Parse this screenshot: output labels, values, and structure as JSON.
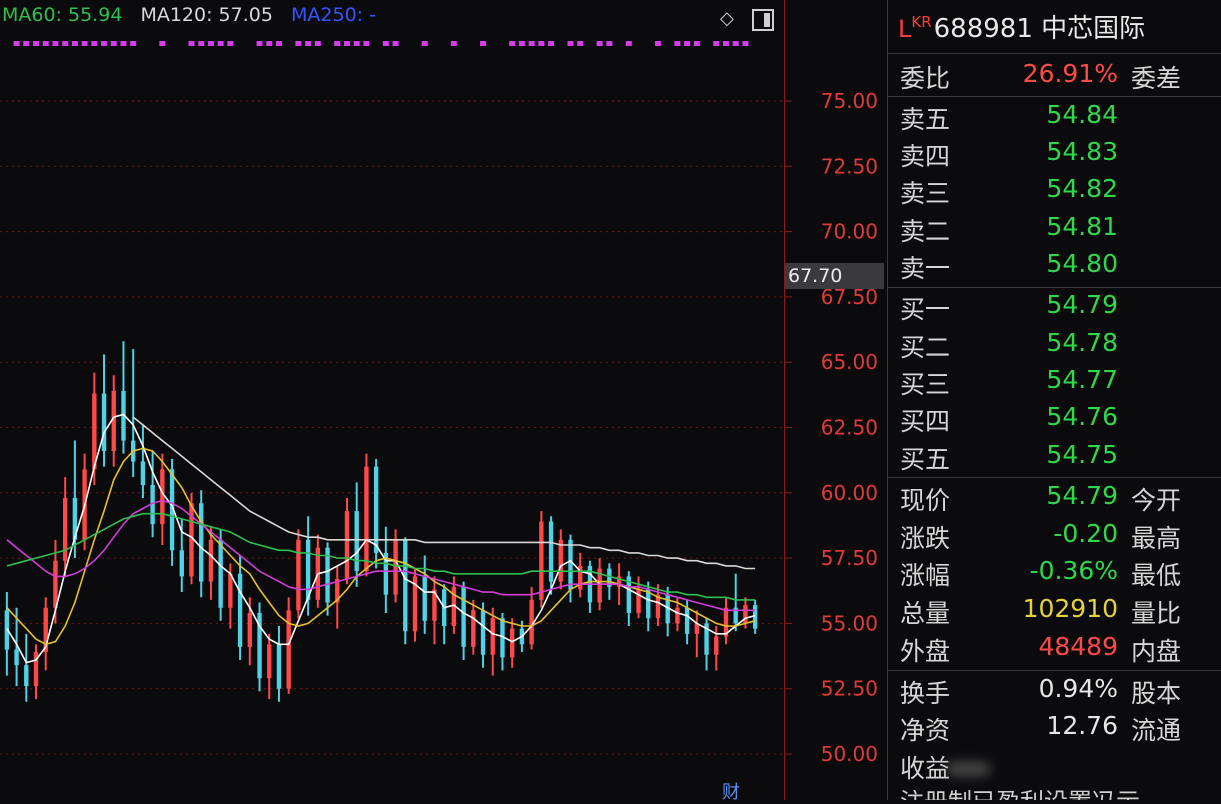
{
  "legend": {
    "ma60": "MA60: 55.94",
    "ma120": "MA120: 57.05",
    "ma250": "MA250: -"
  },
  "icons": {
    "diamond": "diamond-icon",
    "panel": "panel-toggle-icon"
  },
  "badge": "财",
  "current_price_tag": "67.70",
  "colors": {
    "background": "#0b0b0d",
    "up": "#ff4848",
    "down": "#2fd84a",
    "bar_down": "#4fd2e6",
    "grid": "#7a1414",
    "ma5": "#ffffff",
    "ma10": "#e6c229",
    "ma20": "#d43cd8",
    "ma60": "#2fbf4f",
    "ma120": "#d8d8d8",
    "signal": "#d63cf0"
  },
  "chart_data": {
    "type": "candlestick",
    "y_ticks": [
      "75.00",
      "72.50",
      "70.00",
      "67.50",
      "65.00",
      "62.50",
      "60.00",
      "57.50",
      "55.00",
      "52.50",
      "50.00"
    ],
    "ylim": [
      49.5,
      77.5
    ],
    "candles": [
      [
        55.5,
        56.2,
        53.0,
        54.0
      ],
      [
        54.0,
        55.6,
        52.6,
        53.4
      ],
      [
        53.4,
        54.6,
        52.0,
        52.6
      ],
      [
        52.6,
        54.2,
        52.1,
        53.9
      ],
      [
        53.9,
        56.0,
        53.2,
        55.6
      ],
      [
        55.6,
        58.2,
        55.0,
        57.4
      ],
      [
        57.4,
        60.6,
        56.8,
        59.8
      ],
      [
        59.8,
        62.0,
        57.5,
        58.2
      ],
      [
        58.2,
        61.5,
        57.8,
        60.9
      ],
      [
        60.9,
        64.6,
        60.3,
        63.8
      ],
      [
        63.8,
        65.3,
        61.0,
        61.6
      ],
      [
        61.6,
        64.5,
        61.0,
        63.9
      ],
      [
        63.9,
        65.8,
        61.5,
        62.0
      ],
      [
        62.0,
        65.5,
        60.6,
        61.2
      ],
      [
        61.2,
        62.6,
        59.8,
        60.3
      ],
      [
        60.3,
        61.6,
        58.3,
        58.8
      ],
      [
        58.8,
        61.5,
        58.0,
        60.9
      ],
      [
        60.9,
        61.3,
        57.2,
        57.8
      ],
      [
        57.8,
        59.0,
        56.2,
        56.8
      ],
      [
        56.8,
        60.0,
        56.5,
        59.6
      ],
      [
        59.6,
        60.1,
        56.0,
        56.6
      ],
      [
        56.6,
        58.7,
        55.9,
        58.2
      ],
      [
        58.2,
        58.6,
        55.1,
        55.6
      ],
      [
        55.6,
        57.3,
        54.8,
        56.9
      ],
      [
        56.9,
        57.6,
        53.6,
        54.1
      ],
      [
        54.1,
        56.0,
        53.4,
        55.4
      ],
      [
        55.4,
        55.8,
        52.4,
        52.9
      ],
      [
        52.9,
        54.6,
        52.1,
        54.2
      ],
      [
        54.2,
        54.9,
        52.0,
        52.5
      ],
      [
        52.5,
        56.0,
        52.3,
        55.5
      ],
      [
        55.5,
        58.6,
        55.2,
        58.2
      ],
      [
        58.2,
        59.1,
        55.3,
        55.9
      ],
      [
        55.9,
        58.4,
        55.6,
        57.9
      ],
      [
        57.9,
        58.1,
        55.3,
        55.8
      ],
      [
        55.8,
        57.2,
        54.8,
        56.7
      ],
      [
        56.7,
        59.8,
        56.5,
        59.3
      ],
      [
        59.3,
        60.4,
        56.4,
        57.0
      ],
      [
        57.0,
        61.5,
        56.8,
        61.0
      ],
      [
        61.0,
        61.3,
        57.1,
        57.7
      ],
      [
        57.7,
        58.7,
        55.4,
        56.1
      ],
      [
        56.1,
        58.6,
        55.8,
        58.2
      ],
      [
        58.2,
        58.3,
        54.2,
        54.7
      ],
      [
        54.7,
        57.1,
        54.3,
        56.8
      ],
      [
        56.8,
        57.6,
        54.6,
        55.1
      ],
      [
        55.1,
        56.8,
        54.2,
        56.3
      ],
      [
        56.3,
        56.5,
        54.2,
        54.9
      ],
      [
        54.9,
        56.8,
        54.6,
        56.4
      ],
      [
        56.4,
        56.6,
        53.6,
        54.1
      ],
      [
        54.1,
        55.9,
        53.8,
        55.5
      ],
      [
        55.5,
        55.8,
        53.3,
        53.8
      ],
      [
        53.8,
        55.6,
        53.0,
        55.2
      ],
      [
        55.2,
        55.4,
        53.2,
        53.7
      ],
      [
        53.7,
        55.2,
        53.3,
        54.8
      ],
      [
        54.8,
        55.1,
        53.9,
        54.2
      ],
      [
        54.2,
        56.4,
        54.0,
        55.9
      ],
      [
        55.9,
        59.3,
        55.6,
        58.9
      ],
      [
        58.9,
        59.1,
        56.1,
        56.6
      ],
      [
        56.6,
        58.6,
        56.3,
        58.2
      ],
      [
        58.2,
        58.4,
        55.8,
        56.3
      ],
      [
        56.3,
        57.7,
        56.0,
        57.2
      ],
      [
        57.2,
        57.4,
        55.4,
        55.8
      ],
      [
        55.8,
        57.5,
        55.5,
        57.1
      ],
      [
        57.1,
        57.3,
        55.9,
        56.4
      ],
      [
        56.4,
        57.3,
        55.7,
        56.8
      ],
      [
        56.8,
        57.0,
        54.9,
        55.4
      ],
      [
        55.4,
        56.8,
        55.2,
        56.3
      ],
      [
        56.3,
        56.6,
        54.7,
        55.2
      ],
      [
        55.2,
        56.5,
        54.9,
        56.1
      ],
      [
        56.1,
        56.4,
        54.5,
        55.0
      ],
      [
        55.0,
        56.0,
        54.7,
        55.6
      ],
      [
        55.6,
        55.9,
        54.2,
        54.6
      ],
      [
        54.6,
        55.5,
        53.7,
        55.0
      ],
      [
        55.0,
        55.2,
        53.2,
        53.8
      ],
      [
        53.8,
        54.9,
        53.2,
        54.5
      ],
      [
        54.5,
        56.0,
        54.2,
        55.6
      ],
      [
        55.6,
        56.9,
        54.7,
        55.0
      ],
      [
        55.0,
        56.0,
        54.8,
        55.7
      ],
      [
        55.7,
        55.9,
        54.6,
        54.8
      ]
    ],
    "ma_lines": [
      {
        "name": "MA5",
        "values": [
          54.8,
          54.2,
          53.5,
          53.6,
          54.1,
          55.5,
          57.0,
          58.3,
          59.5,
          61.0,
          62.3,
          62.9,
          63.0,
          62.6,
          61.8,
          60.8,
          60.0,
          59.5,
          58.5,
          58.3,
          57.9,
          57.6,
          57.2,
          56.9,
          56.2,
          55.6,
          54.9,
          54.4,
          54.2,
          54.2,
          55.1,
          56.0,
          56.9,
          57.0,
          57.2,
          57.4,
          57.7,
          58.2,
          58.0,
          57.4,
          57.4,
          56.7,
          56.5,
          56.2,
          56.2,
          55.6,
          55.7,
          55.4,
          55.2,
          54.9,
          54.6,
          54.5,
          54.3,
          54.5,
          54.9,
          55.5,
          56.3,
          57.2,
          57.4,
          57.0,
          56.9,
          56.5,
          56.5,
          56.5,
          56.3,
          56.1,
          55.9,
          55.8,
          55.6,
          55.4,
          55.3,
          55.0,
          54.8,
          54.6,
          54.6,
          54.9,
          55.2,
          55.3
        ]
      },
      {
        "name": "MA10",
        "values": [
          55.6,
          55.2,
          54.8,
          54.4,
          54.2,
          54.3,
          54.9,
          55.8,
          57.0,
          58.2,
          59.3,
          60.5,
          61.2,
          61.6,
          61.7,
          61.6,
          61.2,
          60.7,
          60.2,
          59.5,
          58.9,
          58.4,
          58.0,
          57.6,
          57.2,
          56.9,
          56.3,
          55.8,
          55.3,
          55.0,
          54.9,
          55.0,
          55.3,
          55.6,
          55.9,
          56.3,
          56.8,
          57.1,
          57.4,
          57.5,
          57.4,
          57.3,
          57.1,
          56.9,
          56.6,
          56.4,
          56.1,
          55.9,
          55.7,
          55.5,
          55.3,
          55.1,
          55.0,
          54.9,
          54.9,
          55.1,
          55.5,
          55.9,
          56.3,
          56.5,
          56.6,
          56.6,
          56.6,
          56.5,
          56.4,
          56.3,
          56.2,
          56.0,
          55.9,
          55.8,
          55.6,
          55.4,
          55.2,
          55.0,
          54.9,
          54.9,
          55.0,
          55.1
        ]
      },
      {
        "name": "MA20",
        "values": [
          58.2,
          57.9,
          57.6,
          57.3,
          57.0,
          56.8,
          56.8,
          56.9,
          57.1,
          57.4,
          57.8,
          58.3,
          58.8,
          59.2,
          59.4,
          59.6,
          59.7,
          59.6,
          59.4,
          59.1,
          58.8,
          58.5,
          58.2,
          57.9,
          57.6,
          57.3,
          57.0,
          56.8,
          56.6,
          56.4,
          56.3,
          56.3,
          56.4,
          56.5,
          56.6,
          56.7,
          56.8,
          56.9,
          57.0,
          57.0,
          57.0,
          57.0,
          56.9,
          56.8,
          56.7,
          56.6,
          56.5,
          56.4,
          56.3,
          56.2,
          56.2,
          56.1,
          56.1,
          56.1,
          56.1,
          56.2,
          56.3,
          56.4,
          56.5,
          56.5,
          56.5,
          56.5,
          56.5,
          56.5,
          56.4,
          56.4,
          56.3,
          56.2,
          56.1,
          56.0,
          55.9,
          55.8,
          55.7,
          55.6,
          55.5,
          55.5,
          55.5,
          55.5
        ]
      },
      {
        "name": "MA60",
        "values": [
          57.2,
          57.3,
          57.4,
          57.5,
          57.6,
          57.7,
          57.8,
          58.0,
          58.2,
          58.4,
          58.6,
          58.8,
          59.0,
          59.1,
          59.2,
          59.2,
          59.2,
          59.1,
          59.0,
          58.9,
          58.8,
          58.7,
          58.6,
          58.5,
          58.3,
          58.1,
          58.0,
          57.9,
          57.8,
          57.8,
          57.7,
          57.7,
          57.6,
          57.6,
          57.5,
          57.5,
          57.4,
          57.4,
          57.3,
          57.3,
          57.2,
          57.2,
          57.1,
          57.1,
          57.0,
          57.0,
          56.9,
          56.9,
          56.9,
          56.9,
          56.9,
          56.9,
          56.9,
          56.9,
          57.0,
          57.0,
          57.0,
          57.0,
          57.0,
          57.0,
          57.0,
          56.9,
          56.8,
          56.7,
          56.6,
          56.5,
          56.4,
          56.3,
          56.2,
          56.2,
          56.1,
          56.1,
          56.0,
          56.0,
          56.0,
          55.9,
          55.9,
          55.9
        ]
      },
      {
        "name": "MA120",
        "values": [
          null,
          null,
          null,
          null,
          null,
          null,
          null,
          null,
          null,
          null,
          null,
          null,
          null,
          62.9,
          62.6,
          62.3,
          62.0,
          61.7,
          61.4,
          61.1,
          60.8,
          60.5,
          60.2,
          59.9,
          59.6,
          59.3,
          59.1,
          58.9,
          58.7,
          58.5,
          58.4,
          58.3,
          58.3,
          58.2,
          58.2,
          58.2,
          58.2,
          58.2,
          58.2,
          58.2,
          58.2,
          58.2,
          58.2,
          58.1,
          58.1,
          58.1,
          58.1,
          58.1,
          58.1,
          58.1,
          58.1,
          58.1,
          58.1,
          58.1,
          58.1,
          58.1,
          58.1,
          58.0,
          58.0,
          58.0,
          57.9,
          57.9,
          57.8,
          57.8,
          57.7,
          57.7,
          57.6,
          57.6,
          57.5,
          57.5,
          57.4,
          57.4,
          57.3,
          57.3,
          57.2,
          57.2,
          57.1,
          57.1
        ]
      }
    ],
    "signal_marks": [
      1,
      2,
      3,
      4,
      5,
      6,
      7,
      8,
      9,
      10,
      11,
      12,
      13,
      16,
      19,
      20,
      21,
      22,
      23,
      26,
      27,
      28,
      30,
      31,
      32,
      34,
      35,
      36,
      37,
      39,
      40,
      43,
      46,
      49,
      52,
      53,
      54,
      55,
      56,
      58,
      59,
      61,
      62,
      64,
      67,
      69,
      70,
      71,
      73,
      74,
      75,
      76
    ]
  },
  "quote": {
    "title_l": "L",
    "title_kr": "KR",
    "title": "688981 中芯国际",
    "weibi_label": "委比",
    "weibi_value": "26.91%",
    "weicha_label": "委差",
    "asks": [
      {
        "label": "卖五",
        "price": "54.84"
      },
      {
        "label": "卖四",
        "price": "54.83"
      },
      {
        "label": "卖三",
        "price": "54.82"
      },
      {
        "label": "卖二",
        "price": "54.81"
      },
      {
        "label": "卖一",
        "price": "54.80"
      }
    ],
    "bids": [
      {
        "label": "买一",
        "price": "54.79"
      },
      {
        "label": "买二",
        "price": "54.78"
      },
      {
        "label": "买三",
        "price": "54.77"
      },
      {
        "label": "买四",
        "price": "54.76"
      },
      {
        "label": "买五",
        "price": "54.75"
      }
    ],
    "stats": [
      {
        "label": "现价",
        "value": "54.79",
        "label2": "今开"
      },
      {
        "label": "涨跌",
        "value": "-0.20",
        "label2": "最高"
      },
      {
        "label": "涨幅",
        "value": "-0.36%",
        "label2": "最低"
      },
      {
        "label": "总量",
        "value": "102910",
        "label2": "量比"
      },
      {
        "label": "外盘",
        "value": "48489",
        "label2": "内盘"
      }
    ],
    "fundamentals": [
      {
        "label": "换手",
        "value": "0.94%",
        "label2": "股本"
      },
      {
        "label": "净资",
        "value": "12.76",
        "label2": "流通"
      },
      {
        "label": "收益",
        "value": "",
        "label2": ""
      }
    ],
    "bottom_cut_text": "注册制已盈利设置冯示"
  }
}
